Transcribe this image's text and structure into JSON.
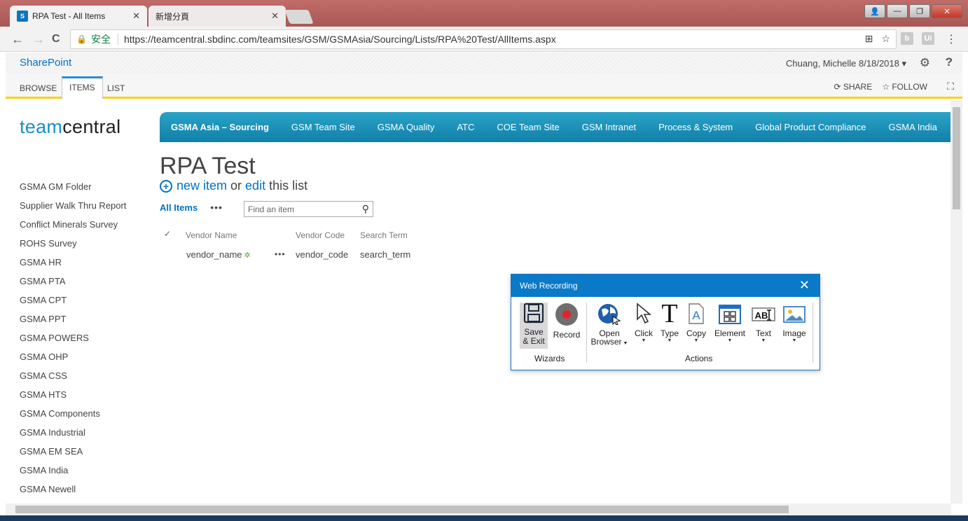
{
  "browser": {
    "tabs": [
      {
        "title": "RPA Test - All Items",
        "favicon": "S"
      },
      {
        "title": "新增分頁"
      }
    ],
    "nav": {
      "back": "←",
      "forward": "→",
      "reload": "C"
    },
    "address": {
      "secure_label": "安全",
      "url": "https://teamcentral.sbdinc.com/teamsites/GSM/GSMAsia/Sourcing/Lists/RPA%20Test/AllItems.aspx"
    },
    "extensions": [
      "b",
      "Ui"
    ]
  },
  "suite": {
    "brand": "SharePoint",
    "user": "Chuang, Michelle 8/18/2018"
  },
  "ribbon": {
    "tabs": [
      "BROWSE",
      "ITEMS",
      "LIST"
    ],
    "share": "SHARE",
    "follow": "FOLLOW"
  },
  "site": {
    "logo_team": "team",
    "logo_central": "central",
    "topnav": [
      "GSMA Asia – Sourcing",
      "GSM Team Site",
      "GSMA Quality",
      "ATC",
      "COE Team Site",
      "GSM Intranet",
      "Process & System",
      "Global Product Compliance",
      "GSMA India"
    ]
  },
  "leftnav": [
    "GSMA GM Folder",
    "Supplier Walk Thru Report",
    "Conflict Minerals Survey",
    "ROHS Survey",
    "GSMA HR",
    "GSMA PTA",
    "GSMA CPT",
    "GSMA PPT",
    "GSMA POWERS",
    "GSMA OHP",
    "GSMA CSS",
    "GSMA HTS",
    "GSMA Components",
    "GSMA Industrial",
    "GSMA EM SEA",
    "GSMA India",
    "GSMA Newell"
  ],
  "list": {
    "title": "RPA Test",
    "new_item": "new item",
    "or": "or",
    "edit": "edit",
    "this_list": "this list",
    "view": "All Items",
    "search_placeholder": "Find an item",
    "columns": [
      "Vendor Name",
      "Vendor Code",
      "Search Term"
    ],
    "rows": [
      {
        "vendor_name": "vendor_name",
        "vendor_code": "vendor_code",
        "search_term": "search_term"
      }
    ]
  },
  "recorder": {
    "title": "Web Recording",
    "save_line1": "Save",
    "save_line2": "& Exit",
    "record": "Record",
    "open_line1": "Open",
    "open_line2": "Browser",
    "click": "Click",
    "type": "Type",
    "copy": "Copy",
    "element": "Element",
    "text": "Text",
    "image": "Image",
    "group_wizards": "Wizards",
    "group_actions": "Actions"
  }
}
